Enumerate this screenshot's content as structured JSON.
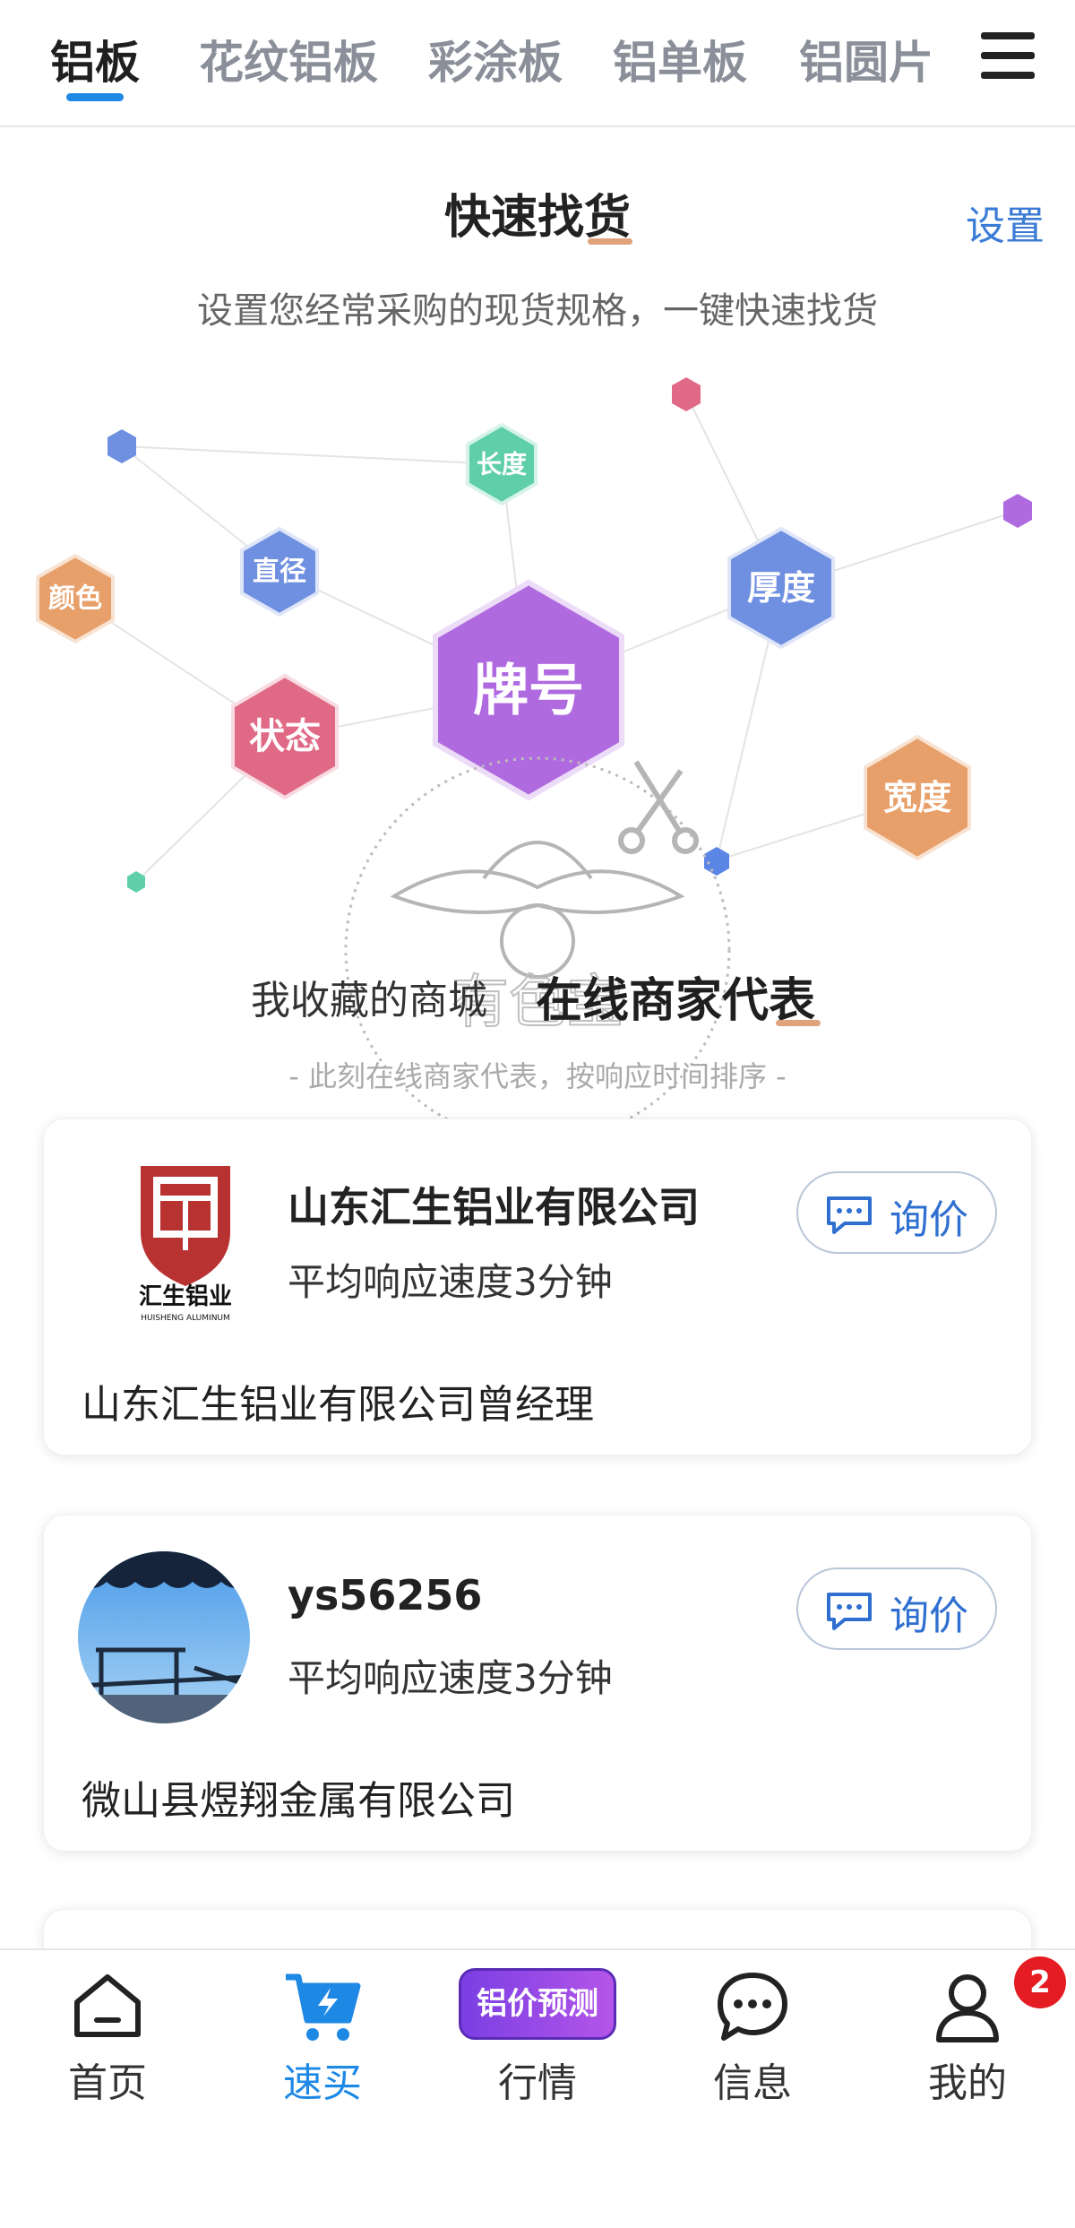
{
  "tabs": [
    {
      "label": "铝板",
      "active": true
    },
    {
      "label": "花纹铝板",
      "active": false
    },
    {
      "label": "彩涂板",
      "active": false
    },
    {
      "label": "铝单板",
      "active": false
    },
    {
      "label": "铝圆片",
      "active": false
    }
  ],
  "menu_icon": "hamburger-menu-icon",
  "quick_find": {
    "title": "快速找货",
    "settings_label": "设置",
    "subtitle": "设置您经常采购的现货规格，一键快速找货",
    "nodes": {
      "grade": "牌号",
      "thickness": "厚度",
      "width": "宽度",
      "temper": "状态",
      "diameter": "直径",
      "length": "长度",
      "color": "颜色"
    }
  },
  "sections": {
    "favorites_tab": "我收藏的商城",
    "online_tab": "在线商家代表",
    "subtitle": "- 此刻在线商家代表，按响应时间排序 -"
  },
  "merchants": [
    {
      "name": "山东汇生铝业有限公司",
      "speed": "平均响应速度3分钟",
      "person": "山东汇生铝业有限公司曾经理",
      "inquiry_label": "询价",
      "logo_text": "汇生铝业",
      "logo_subtext": "HUISHENG ALUMINUM"
    },
    {
      "name": "ys56256",
      "speed": "平均响应速度3分钟",
      "person": "微山县煜翔金属有限公司",
      "inquiry_label": "询价"
    }
  ],
  "watermark_text": "有色宝",
  "bottom_nav": [
    {
      "label": "首页",
      "icon": "home-icon",
      "active": false
    },
    {
      "label": "速买",
      "icon": "cart-lightning-icon",
      "active": true
    },
    {
      "label": "行情",
      "icon": "price-forecast-badge",
      "active": false,
      "badge_text": "铝价预测"
    },
    {
      "label": "信息",
      "icon": "chat-bubble-icon",
      "active": false
    },
    {
      "label": "我的",
      "icon": "user-icon",
      "active": false
    }
  ],
  "notification_count": "2",
  "colors": {
    "accent_blue": "#1e88e5",
    "underline_orange": "#e0a27a",
    "hex_purple": "#b06ae0",
    "hex_blue": "#6f8fe0",
    "hex_orange": "#e8a06a",
    "hex_pink": "#e06a86",
    "hex_green": "#5ecfa8",
    "badge_red": "#e51c23"
  }
}
